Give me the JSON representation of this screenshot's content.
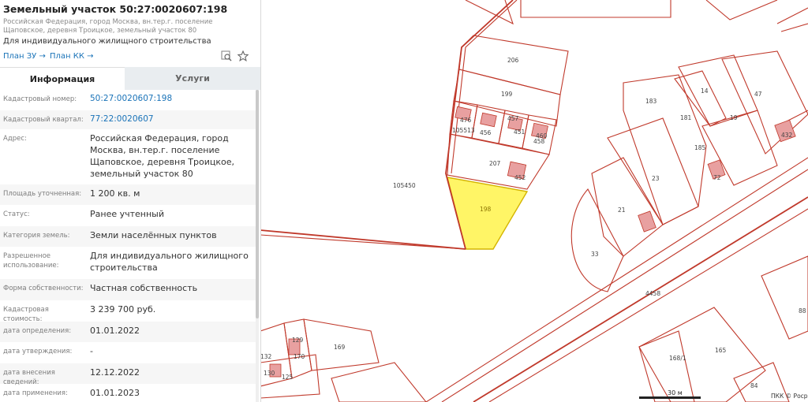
{
  "header": {
    "title": "Земельный участок 50:27:0020607:198",
    "address_small": "Российская Федерация, город Москва, вн.тер.г. поселение Щаповское, деревня Троицкое, земельный участок 80",
    "permitted_use": "Для индивидуального жилищного строительства",
    "plan_zu_label": "План ЗУ →",
    "plan_kk_label": "План КК →",
    "icons": [
      "zoom-to-parcel-icon",
      "favorite-star-icon"
    ]
  },
  "tabs": [
    {
      "label": "Информация",
      "active": true
    },
    {
      "label": "Услуги",
      "active": false
    }
  ],
  "info": [
    {
      "label": "Кадастровый номер:",
      "value": "50:27:0020607:198",
      "link": true
    },
    {
      "label": "Кадастровый квартал:",
      "value": "77:22:0020607",
      "link": true
    },
    {
      "label": "Адрес:",
      "value": "Российская Федерация, город Москва, вн.тер.г. поселение Щаповское, деревня Троицкое, земельный участок 80"
    },
    {
      "label": "Площадь уточненная:",
      "value": "1 200 кв. м"
    },
    {
      "label": "Статус:",
      "value": "Ранее учтенный"
    },
    {
      "label": "Категория земель:",
      "value": "Земли населённых пунктов"
    },
    {
      "label": "Разрешенное использование:",
      "value": "Для индивидуального жилищного строительства"
    },
    {
      "label": "Форма собственности:",
      "value": "Частная собственность"
    },
    {
      "label": "Кадастровая стоимость:",
      "value": "3 239 700 руб."
    },
    {
      "label": "дата определения:",
      "value": "01.01.2022"
    },
    {
      "label": "дата утверждения:",
      "value": "-"
    },
    {
      "label": "дата внесения сведений:",
      "value": "12.12.2022"
    },
    {
      "label": "дата применения:",
      "value": "01.01.2023"
    }
  ],
  "map": {
    "parcel_labels": [
      "206",
      "199",
      "476",
      "456",
      "457",
      "451",
      "458",
      "460",
      "105513",
      "207",
      "452",
      "198",
      "105450",
      "14",
      "47",
      "183",
      "181",
      "19",
      "432",
      "185",
      "23",
      "72",
      "21",
      "33",
      "4458",
      "132",
      "129",
      "170",
      "169",
      "130",
      "125",
      "165",
      "168/1",
      "88",
      "84"
    ],
    "highlight_label": "198",
    "scale_label": "30 м",
    "copyright": "ПКК © Росреестр",
    "colors": {
      "boundary": "#c0392b",
      "building": "#e8a0a0",
      "highlight_fill": "#fff566",
      "highlight_stroke": "#d4b400"
    }
  }
}
